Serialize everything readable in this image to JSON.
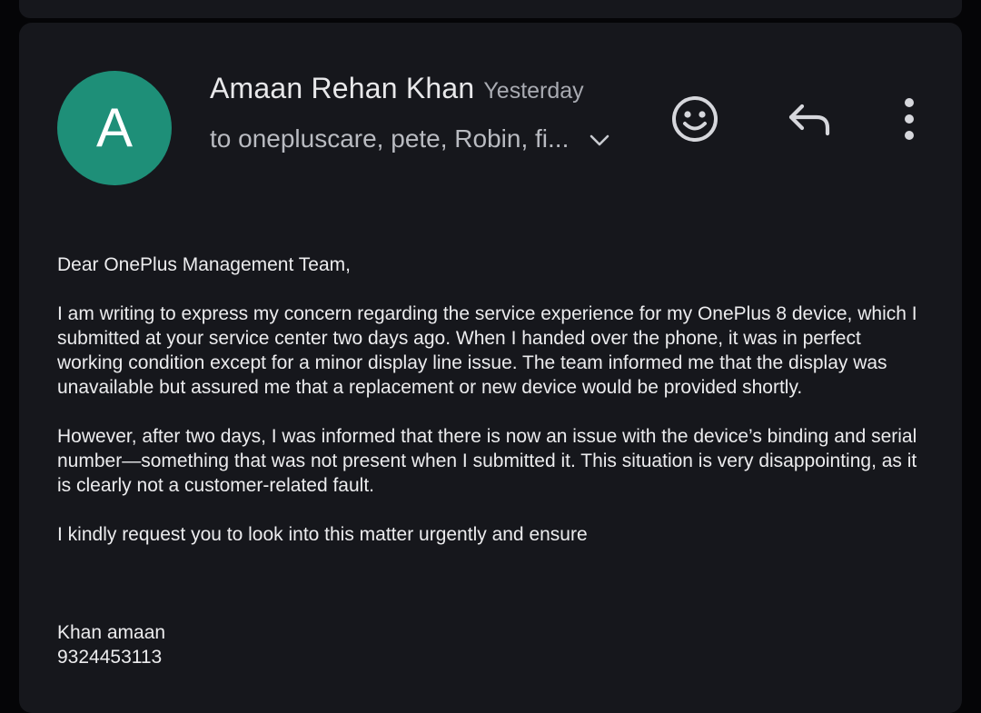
{
  "email": {
    "avatar_letter": "A",
    "avatar_color": "#1e8f78",
    "sender_name": "Amaan Rehan Khan",
    "timestamp": "Yesterday",
    "recipients": "to onepluscare, pete, Robin, fi...",
    "icons": {
      "emoji": "smiley-face-icon",
      "reply": "reply-arrow-icon",
      "more": "vertical-dots-icon",
      "expand": "chevron-down-icon"
    },
    "body": {
      "greeting": "Dear OnePlus Management Team,",
      "paragraph_1": "I am writing to express my concern regarding the service experience for my OnePlus 8 device, which I submitted at your service center two days ago. When I handed over the phone, it was in perfect working condition except for a minor display line issue. The team informed me that the display was unavailable but assured me that a replacement or new device would be provided shortly.",
      "paragraph_2": "However, after two days, I was informed that there is now an issue with the device’s binding and serial number—something that was not present when I submitted it. This situation is very disappointing, as it is clearly not a customer-related fault.",
      "paragraph_3": "I kindly request you to look into this matter urgently and ensure"
    },
    "signature": {
      "name": "Khan amaan",
      "phone": "9324453113"
    }
  }
}
